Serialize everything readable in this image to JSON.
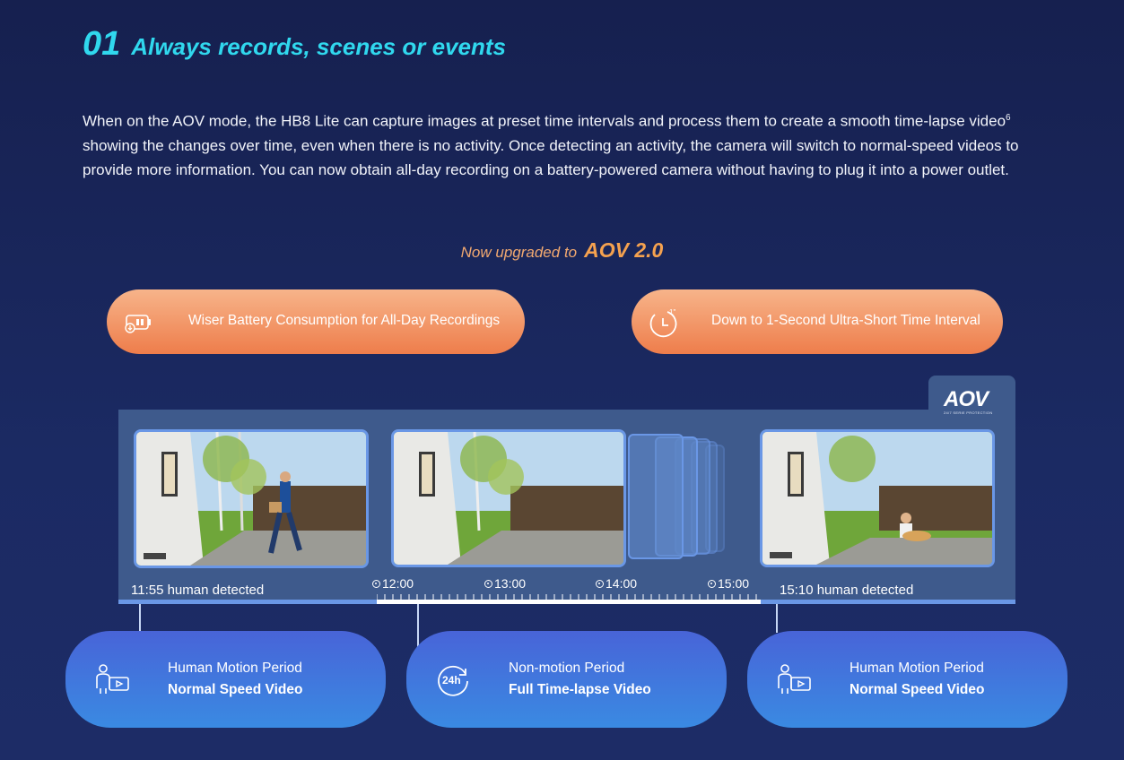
{
  "section": {
    "number": "01",
    "title": "Always records, scenes or events",
    "description_main": "When on the AOV mode, the HB8 Lite can capture images at preset time intervals and process them to create a smooth time-lapse video",
    "description_sup": "6",
    "description_rest": " showing the changes over time, even when there is no activity. Once detecting an activity, the camera will switch to normal-speed videos to provide more information. You can now obtain all-day recording on a battery-powered camera without having to plug it into a power outlet."
  },
  "upgrade": {
    "prefix": "Now upgraded to",
    "name": "AOV 2.0"
  },
  "features": [
    {
      "icon": "battery-icon",
      "label": "Wiser Battery Consumption for All-Day Recordings"
    },
    {
      "icon": "timer-icon",
      "label": "Down to 1-Second Ultra-Short Time Interval",
      "icon_text": "1\""
    }
  ],
  "logo": {
    "text": "AOV",
    "tagline": "24/7 SERIE PROTECTION"
  },
  "timeline": {
    "left_event": "11:55 human detected",
    "right_event": "15:10 human detected",
    "ticks": [
      "12:00",
      "13:00",
      "14:00",
      "15:00"
    ]
  },
  "cards": [
    {
      "icon": "person-video-icon",
      "line1": "Human Motion Period",
      "line2": "Normal Speed Video"
    },
    {
      "icon": "24h-icon",
      "icon_text": "24h",
      "line1": "Non-motion Period",
      "line2": "Full Time-lapse Video"
    },
    {
      "icon": "person-video-icon",
      "line1": "Human Motion Period",
      "line2": "Normal Speed Video"
    }
  ],
  "colors": {
    "background": "#16204f",
    "heading": "#30d8ee",
    "accent_orange": "#ee7d4b",
    "card_blue": "#3a8ae2",
    "panel": "#3e5a8c"
  }
}
